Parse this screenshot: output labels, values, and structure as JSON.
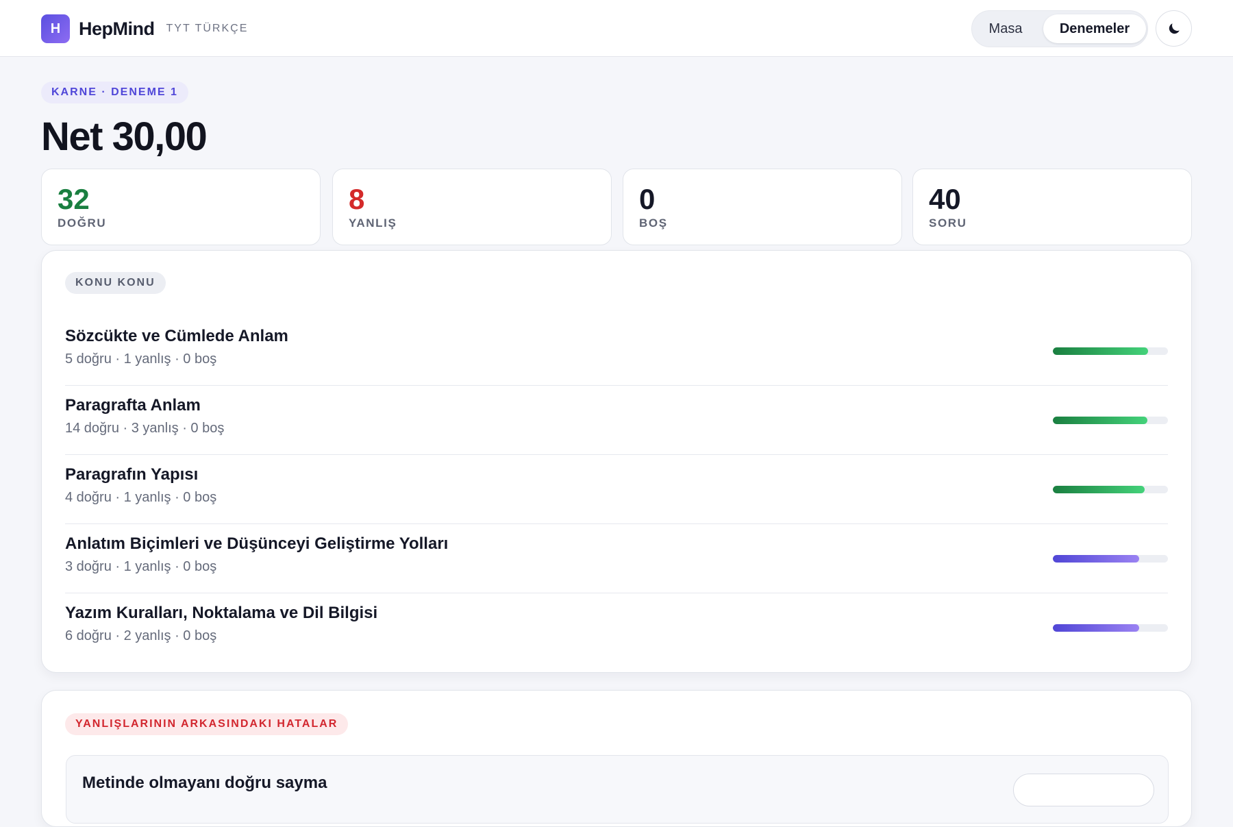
{
  "header": {
    "logo_letter": "H",
    "brand": "HepMind",
    "subtitle": "TYT TÜRKÇE",
    "nav": [
      {
        "label": "Masa",
        "active": false
      },
      {
        "label": "Denemeler",
        "active": true
      }
    ],
    "theme_icon": "moon-icon"
  },
  "report": {
    "badge": "KARNE · DENEME 1",
    "net_title": "Net 30,00"
  },
  "stats": [
    {
      "value": "32",
      "label": "DOĞRU",
      "color": "#1a7f40"
    },
    {
      "value": "8",
      "label": "YANLIŞ",
      "color": "#d42a2a"
    },
    {
      "value": "0",
      "label": "BOŞ",
      "color": "#151827"
    },
    {
      "value": "40",
      "label": "SORU",
      "color": "#151827"
    }
  ],
  "topics": {
    "badge": "KONU KONU",
    "items": [
      {
        "name": "Sözcükte ve Cümlede Anlam",
        "meta": "5 doğru · 1 yanlış · 0 boş",
        "score_pct": 83,
        "color": "green"
      },
      {
        "name": "Paragrafta Anlam",
        "meta": "14 doğru · 3 yanlış · 0 boş",
        "score_pct": 82,
        "color": "green"
      },
      {
        "name": "Paragrafın Yapısı",
        "meta": "4 doğru · 1 yanlış · 0 boş",
        "score_pct": 80,
        "color": "green"
      },
      {
        "name": "Anlatım Biçimleri ve Düşünceyi Geliştirme Yolları",
        "meta": "3 doğru · 1 yanlış · 0 boş",
        "score_pct": 75,
        "color": "purple"
      },
      {
        "name": "Yazım Kuralları, Noktalama ve Dil Bilgisi",
        "meta": "6 doğru · 2 yanlış · 0 boş",
        "score_pct": 75,
        "color": "purple"
      }
    ]
  },
  "errors": {
    "badge": "YANLIŞLARININ ARKASINDAKI HATALAR",
    "first_item_title": "Metinde olmayanı doğru sayma"
  },
  "colors": {
    "accent": "#4f46d8",
    "correct": "#1a7f40",
    "wrong": "#d42a2a",
    "background": "#f5f6fa"
  }
}
